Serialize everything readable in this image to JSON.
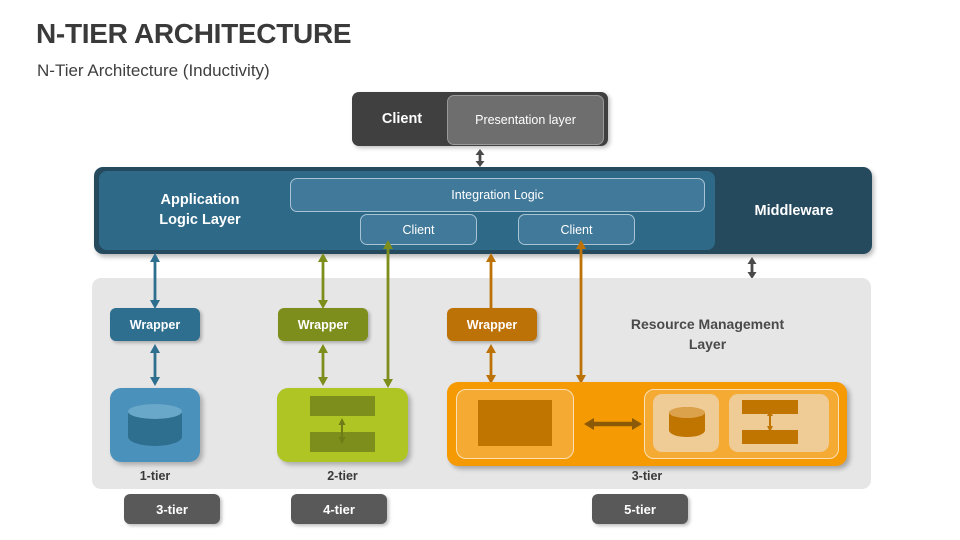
{
  "header": {
    "title": "N-TIER ARCHITECTURE",
    "subtitle": "N-Tier Architecture (Inductivity)"
  },
  "client_strip": {
    "client_label": "Client",
    "presentation_label": "Presentation layer"
  },
  "middleware_band": {
    "application_logic_label": "Application Logic Layer",
    "application_logic_line1": "Application",
    "application_logic_line2": "Logic Layer",
    "middleware_label": "Middleware",
    "integration_logic_label": "Integration Logic",
    "sub_clients": [
      "Client",
      "Client"
    ]
  },
  "resource_layer": {
    "label_line1": "Resource Management",
    "label_line2": "Layer",
    "wrappers": [
      {
        "label": "Wrapper",
        "color": "#2e6e8e"
      },
      {
        "label": "Wrapper",
        "color": "#7e8e1c"
      },
      {
        "label": "Wrapper",
        "color": "#bd7208"
      }
    ],
    "tiers": [
      {
        "caption": "1-tier",
        "color": "#4a92bc"
      },
      {
        "caption": "2-tier",
        "color": "#afc524"
      },
      {
        "caption": "3-tier",
        "color": "#f59a02"
      }
    ]
  },
  "bottom_badges": [
    "3-tier",
    "4-tier",
    "5-tier"
  ],
  "colors": {
    "title_text": "#3a3a3a",
    "client_box": "#404040",
    "presentation_box": "#6e6e6e",
    "middleware_navy": "#254a5e",
    "application_logic_teal": "#2e6a88",
    "integration_bar": "#41799a",
    "resource_panel": "#e6e6e6",
    "tier1_blue": "#4a92bc",
    "tier2_olive": "#afc524",
    "tier3_orange": "#f59a02",
    "badge_gray": "#595959",
    "arrow_blue": "#2e6e8e",
    "arrow_olive": "#7e8e1c",
    "arrow_orange": "#bd7208",
    "arrow_gray": "#4a4a4a"
  }
}
